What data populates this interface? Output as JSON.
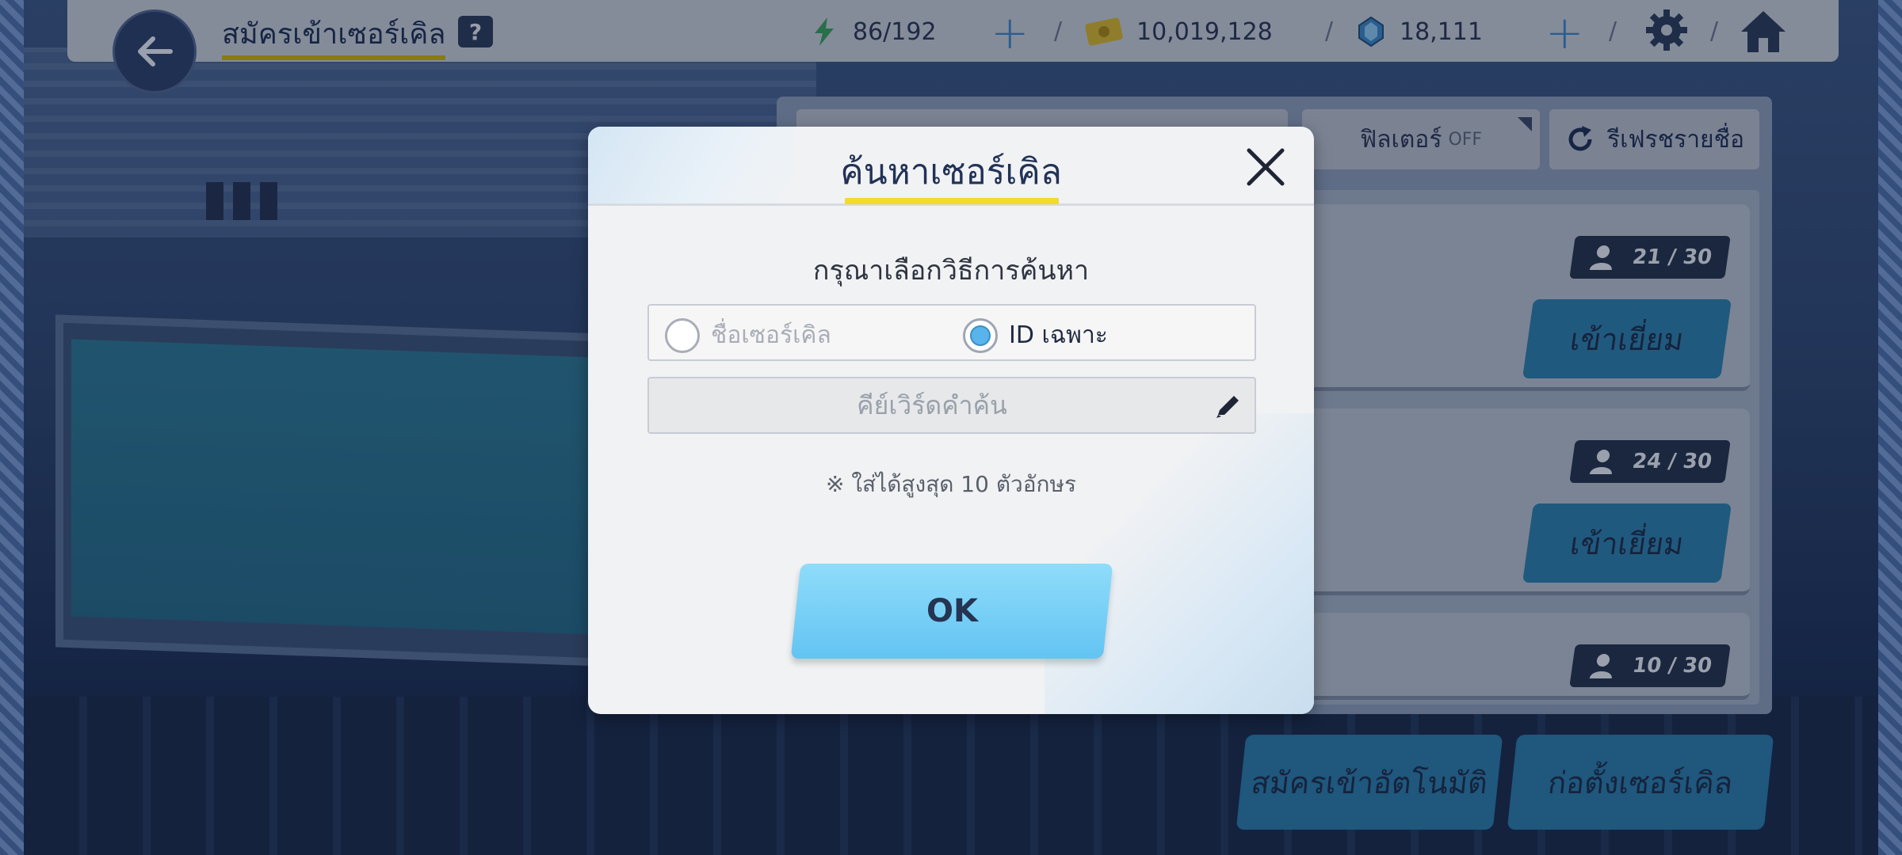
{
  "header": {
    "title": "สมัครเข้าเซอร์เคิล",
    "help_label": "?",
    "stamina": "86/192",
    "gold": "10,019,128",
    "gems": "18,111"
  },
  "toolbar": {
    "filter_label": "ฟิลเตอร์",
    "filter_state": "OFF",
    "refresh_label": "รีเฟรชรายชื่อ"
  },
  "circles": [
    {
      "members": "21 / 30",
      "visit_label": "เข้าเยี่ยม"
    },
    {
      "members": "24 / 30",
      "visit_label": "เข้าเยี่ยม"
    },
    {
      "members": "10 / 30"
    }
  ],
  "bottom": {
    "auto_join_label": "สมัครเข้าอัตโนมัติ",
    "create_label": "ก่อตั้งเซอร์เคิล"
  },
  "modal": {
    "title": "ค้นหาเซอร์เคิล",
    "prompt": "กรุณาเลือกวิธีการค้นหา",
    "options": [
      {
        "label": "ชื่อเซอร์เคิล",
        "selected": false
      },
      {
        "label": "ID เฉพาะ",
        "selected": true
      }
    ],
    "keyword_placeholder": "คีย์เวิร์ดคำค้น",
    "keyword_value": "",
    "note": "※ ใส่ได้สูงสุด 10 ตัวอักษร",
    "ok_label": "OK"
  },
  "colors": {
    "accent_blue": "#63c4f2",
    "title_underline": "#f0dc29",
    "dark_navy": "#223256"
  }
}
